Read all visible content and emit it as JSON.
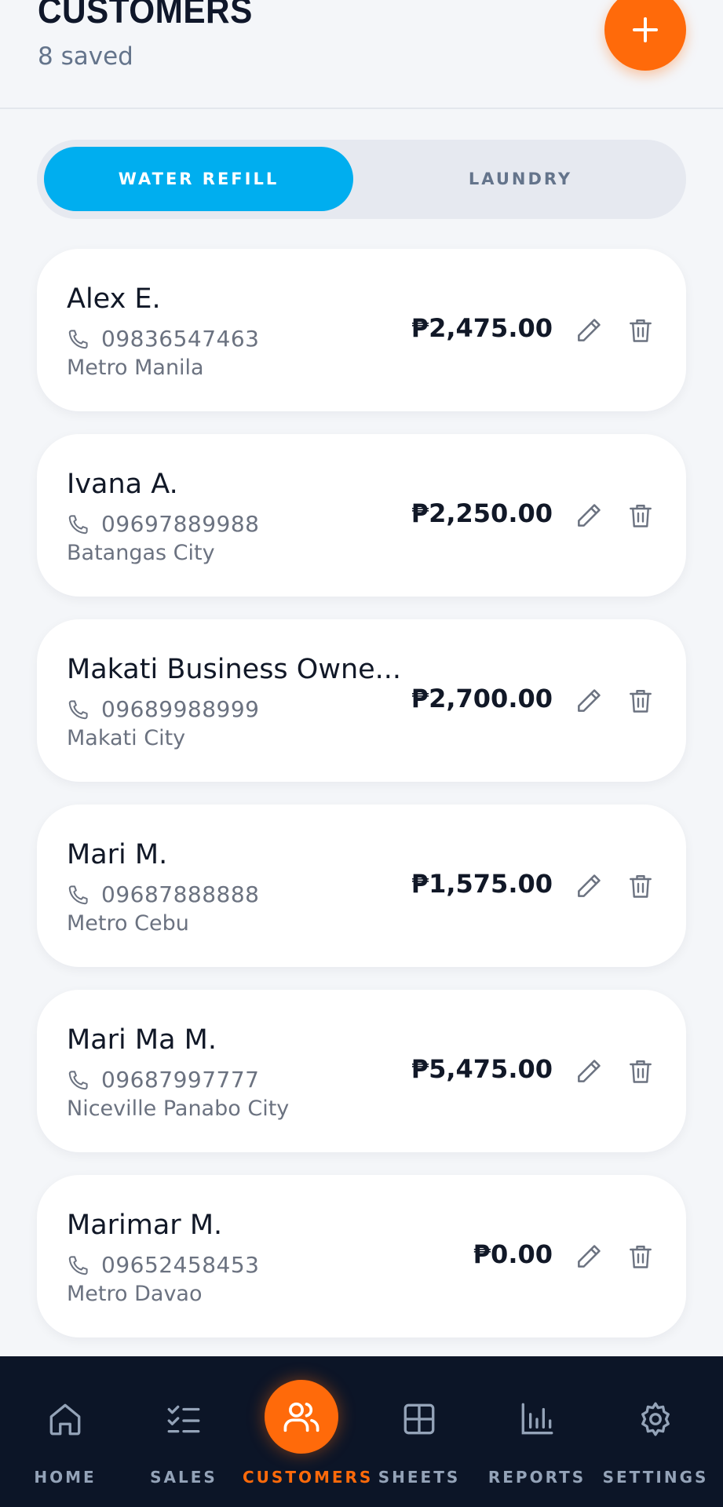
{
  "header": {
    "title": "CUSTOMERS",
    "subtitle": "8 saved",
    "add_icon": "plus-icon"
  },
  "tabs": [
    {
      "label": "WATER REFILL",
      "active": true
    },
    {
      "label": "LAUNDRY",
      "active": false
    }
  ],
  "customers": [
    {
      "name": "Alex E.",
      "phone": "09836547463",
      "location": "Metro Manila",
      "balance": "₱2,475.00"
    },
    {
      "name": "Ivana A.",
      "phone": "09697889988",
      "location": "Batangas City",
      "balance": "₱2,250.00"
    },
    {
      "name": "Makati Business Owne...",
      "phone": "09689988999",
      "location": "Makati City",
      "balance": "₱2,700.00"
    },
    {
      "name": "Mari M.",
      "phone": "09687888888",
      "location": "Metro Cebu",
      "balance": "₱1,575.00"
    },
    {
      "name": "Mari Ma M.",
      "phone": "09687997777",
      "location": "Niceville Panabo City",
      "balance": "₱5,475.00"
    },
    {
      "name": "Marimar M.",
      "phone": "09652458453",
      "location": "Metro Davao",
      "balance": "₱0.00"
    }
  ],
  "nav": [
    {
      "label": "HOME",
      "icon": "home-icon"
    },
    {
      "label": "SALES",
      "icon": "checklist-icon"
    },
    {
      "label": "CUSTOMERS",
      "icon": "users-icon",
      "active": true
    },
    {
      "label": "SHEETS",
      "icon": "grid-icon"
    },
    {
      "label": "REPORTS",
      "icon": "bar-chart-icon"
    },
    {
      "label": "SETTINGS",
      "icon": "gear-icon"
    }
  ],
  "colors": {
    "accent": "#ff6a0a",
    "tab_active": "#00aeef",
    "nav_bg": "#0c1527"
  }
}
